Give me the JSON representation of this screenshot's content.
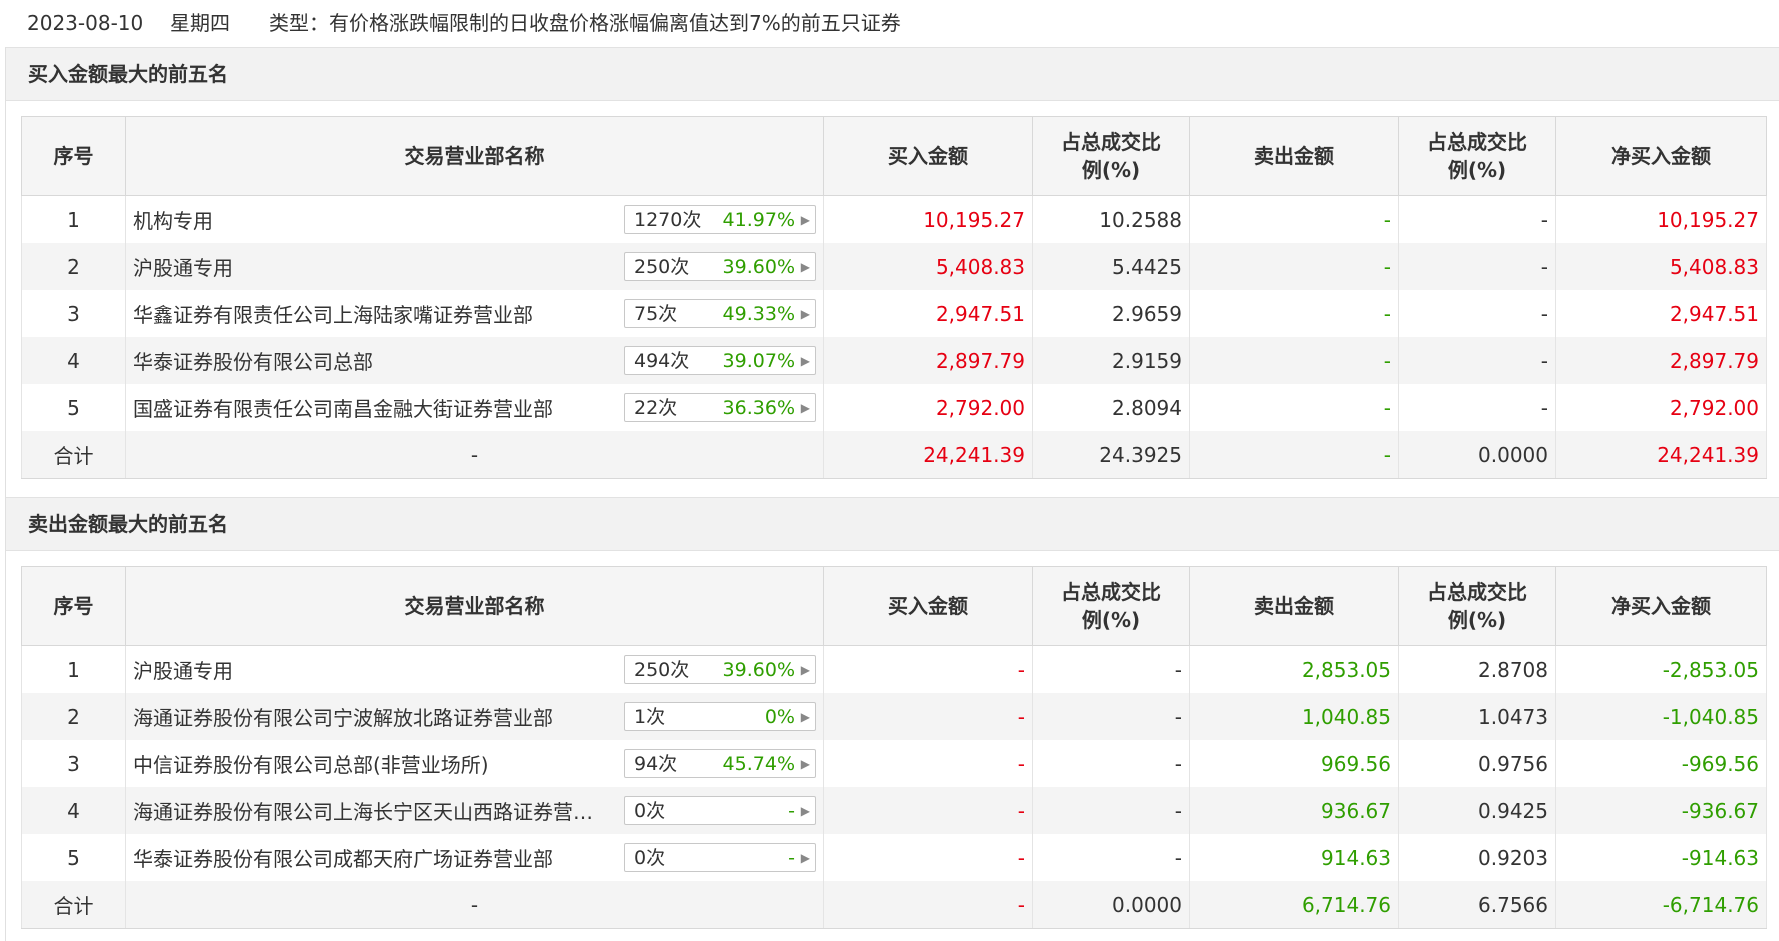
{
  "header": {
    "date": "2023-08-10",
    "weekday": "星期四",
    "type_text": "类型：有价格涨跌幅限制的日收盘价格涨幅偏离值达到7%的前五只证券"
  },
  "columns": {
    "seq": "序号",
    "name": "交易营业部名称",
    "buy": "买入金额",
    "buy_pct_1": "占总成交比",
    "buy_pct_2": "例(%)",
    "sell": "卖出金额",
    "sell_pct_1": "占总成交比",
    "sell_pct_2": "例(%)",
    "net": "净买入金额"
  },
  "buy_section": {
    "title": "买入金额最大的前五名",
    "rows": [
      {
        "seq": "1",
        "name": "机构专用",
        "count": "1270次",
        "rate": "41.97%",
        "buy": "10,195.27",
        "buy_pct": "10.2588",
        "sell": "-",
        "sell_pct": "-",
        "net": "10,195.27"
      },
      {
        "seq": "2",
        "name": "沪股通专用",
        "count": "250次",
        "rate": "39.60%",
        "buy": "5,408.83",
        "buy_pct": "5.4425",
        "sell": "-",
        "sell_pct": "-",
        "net": "5,408.83"
      },
      {
        "seq": "3",
        "name": "华鑫证券有限责任公司上海陆家嘴证券营业部",
        "count": "75次",
        "rate": "49.33%",
        "buy": "2,947.51",
        "buy_pct": "2.9659",
        "sell": "-",
        "sell_pct": "-",
        "net": "2,947.51"
      },
      {
        "seq": "4",
        "name": "华泰证券股份有限公司总部",
        "count": "494次",
        "rate": "39.07%",
        "buy": "2,897.79",
        "buy_pct": "2.9159",
        "sell": "-",
        "sell_pct": "-",
        "net": "2,897.79"
      },
      {
        "seq": "5",
        "name": "国盛证券有限责任公司南昌金融大街证券营业部",
        "count": "22次",
        "rate": "36.36%",
        "buy": "2,792.00",
        "buy_pct": "2.8094",
        "sell": "-",
        "sell_pct": "-",
        "net": "2,792.00"
      }
    ],
    "total": {
      "label": "合计",
      "name": "-",
      "buy": "24,241.39",
      "buy_pct": "24.3925",
      "sell": "-",
      "sell_pct": "0.0000",
      "net": "24,241.39"
    }
  },
  "sell_section": {
    "title": "卖出金额最大的前五名",
    "rows": [
      {
        "seq": "1",
        "name": "沪股通专用",
        "count": "250次",
        "rate": "39.60%",
        "buy": "-",
        "buy_pct": "-",
        "sell": "2,853.05",
        "sell_pct": "2.8708",
        "net": "-2,853.05"
      },
      {
        "seq": "2",
        "name": "海通证券股份有限公司宁波解放北路证券营业部",
        "count": "1次",
        "rate": "0%",
        "buy": "-",
        "buy_pct": "-",
        "sell": "1,040.85",
        "sell_pct": "1.0473",
        "net": "-1,040.85"
      },
      {
        "seq": "3",
        "name": "中信证券股份有限公司总部(非营业场所)",
        "count": "94次",
        "rate": "45.74%",
        "buy": "-",
        "buy_pct": "-",
        "sell": "969.56",
        "sell_pct": "0.9756",
        "net": "-969.56"
      },
      {
        "seq": "4",
        "name": "海通证券股份有限公司上海长宁区天山西路证券营…",
        "count": "0次",
        "rate": "-",
        "buy": "-",
        "buy_pct": "-",
        "sell": "936.67",
        "sell_pct": "0.9425",
        "net": "-936.67"
      },
      {
        "seq": "5",
        "name": "华泰证券股份有限公司成都天府广场证券营业部",
        "count": "0次",
        "rate": "-",
        "buy": "-",
        "buy_pct": "-",
        "sell": "914.63",
        "sell_pct": "0.9203",
        "net": "-914.63"
      }
    ],
    "total": {
      "label": "合计",
      "name": "-",
      "buy": "-",
      "buy_pct": "0.0000",
      "sell": "6,714.76",
      "sell_pct": "6.7566",
      "net": "-6,714.76"
    }
  },
  "colors": {
    "positive": "#e60012",
    "negative": "#2f9e00",
    "header_bg": "#f2f2f2"
  }
}
